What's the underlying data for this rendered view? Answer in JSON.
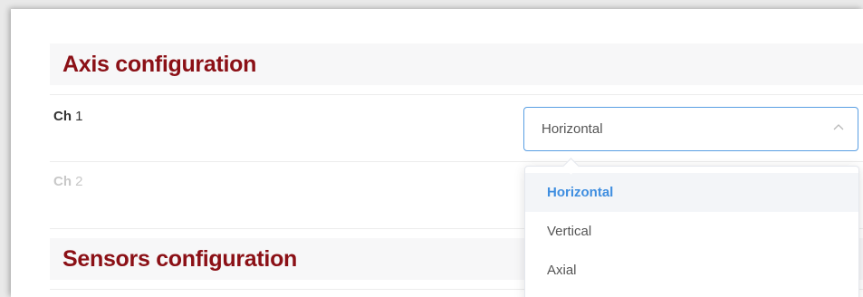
{
  "axis_section": {
    "title": "Axis configuration",
    "channels": [
      {
        "prefix": "Ch",
        "number": "1"
      },
      {
        "prefix": "Ch",
        "number": "2"
      }
    ],
    "select": {
      "value": "Horizontal",
      "options": [
        "Horizontal",
        "Vertical",
        "Axial"
      ]
    }
  },
  "sensors_section": {
    "title": "Sensors configuration"
  },
  "colors": {
    "header_text": "#8b1016",
    "accent": "#3f8ee0",
    "select_border": "#5a9fe3"
  },
  "icons": {
    "select_chevron": "chevron-up-icon"
  }
}
